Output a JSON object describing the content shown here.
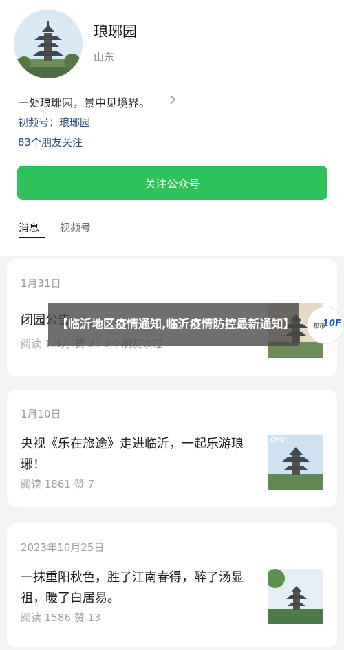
{
  "account": {
    "name": "琅琊园",
    "region": "山东",
    "bio": "一处琅琊园，景中见境界。",
    "channel": "视频号：琅琊园",
    "friends_following": "83个朋友关注"
  },
  "follow_button": "关注公众号",
  "tabs": [
    {
      "label": "消息",
      "active": true
    },
    {
      "label": "视频号",
      "active": false
    }
  ],
  "posts": [
    {
      "date": "1月31日",
      "title": "闭园公告",
      "stats": "阅读 1.3万  赞 21  2个朋友读过"
    },
    {
      "date": "1月10日",
      "title": "央视《乐在旅途》走进临沂，一起乐游琅琊！",
      "stats": "阅读 1861  赞 7",
      "thumb_caption": "CMG"
    },
    {
      "date": "2023年10月25日",
      "title": "一抹重阳秋色，胜了江南春得，醉了汤显祖，暖了白居易。",
      "stats": "阅读 1586  赞 13"
    }
  ],
  "overlay_headline": "【临沂地区疫情通知,临沂疫情防控最新通知】",
  "badge": {
    "text": "都市",
    "number": "10F"
  },
  "colors": {
    "accent_green": "#2fc15a",
    "link_blue": "#2a4b7c"
  }
}
